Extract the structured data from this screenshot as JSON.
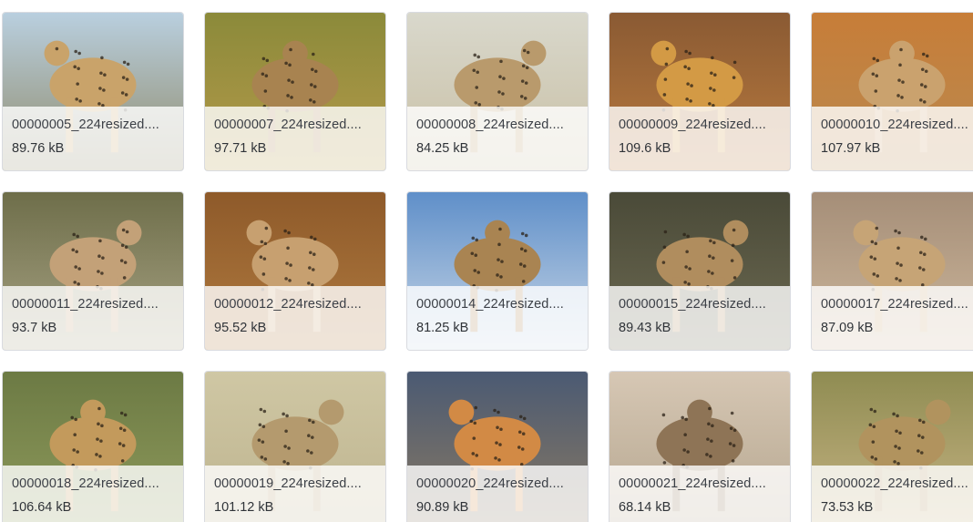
{
  "files": [
    {
      "name": "00000005_224resized....",
      "size": "89.76 kB",
      "colors": {
        "sky": "#b9cfdf",
        "ground": "#8f8a6a",
        "cat": "#c9a36a"
      }
    },
    {
      "name": "00000007_224resized....",
      "size": "97.71 kB",
      "colors": {
        "sky": "#8b8a3a",
        "ground": "#b59a4a",
        "cat": "#a88350"
      }
    },
    {
      "name": "00000008_224resized....",
      "size": "84.25 kB",
      "colors": {
        "sky": "#d9d8cc",
        "ground": "#c8bfa4",
        "cat": "#b99a6c"
      }
    },
    {
      "name": "00000009_224resized....",
      "size": "109.6 kB",
      "colors": {
        "sky": "#8a5a33",
        "ground": "#b97a3e",
        "cat": "#d39a45"
      }
    },
    {
      "name": "00000010_224resized....",
      "size": "107.97 kB",
      "colors": {
        "sky": "#c77d38",
        "ground": "#b98a50",
        "cat": "#caa26e"
      }
    },
    {
      "name": "00000011_224resized....",
      "size": "93.7 kB",
      "colors": {
        "sky": "#6e6e4a",
        "ground": "#a8a384",
        "cat": "#c3a178"
      }
    },
    {
      "name": "00000012_224resized....",
      "size": "95.52 kB",
      "colors": {
        "sky": "#8e5a2a",
        "ground": "#b07a3f",
        "cat": "#c7a070"
      }
    },
    {
      "name": "00000014_224resized....",
      "size": "81.25 kB",
      "colors": {
        "sky": "#5f8fc9",
        "ground": "#c9d7e6",
        "cat": "#a98452"
      }
    },
    {
      "name": "00000015_224resized....",
      "size": "89.43 kB",
      "colors": {
        "sky": "#4a4a38",
        "ground": "#6d6a52",
        "cat": "#b08d5e"
      }
    },
    {
      "name": "00000017_224resized....",
      "size": "87.09 kB",
      "colors": {
        "sky": "#a58e78",
        "ground": "#cdb79c",
        "cat": "#c6a476"
      }
    },
    {
      "name": "00000018_224resized....",
      "size": "106.64 kB",
      "colors": {
        "sky": "#6c7a44",
        "ground": "#8f9b5c",
        "cat": "#c39a5c"
      }
    },
    {
      "name": "00000019_224resized....",
      "size": "101.12 kB",
      "colors": {
        "sky": "#cfc7a4",
        "ground": "#bdb38e",
        "cat": "#b49a6e"
      }
    },
    {
      "name": "00000020_224resized....",
      "size": "90.89 kB",
      "colors": {
        "sky": "#4b5a73",
        "ground": "#8a7a62",
        "cat": "#d28a45"
      }
    },
    {
      "name": "00000021_224resized....",
      "size": "68.14 kB",
      "colors": {
        "sky": "#d6c7b4",
        "ground": "#b4a58e",
        "cat": "#8e7456"
      }
    },
    {
      "name": "00000022_224resized....",
      "size": "73.53 kB",
      "colors": {
        "sky": "#8f8c52",
        "ground": "#c7b484",
        "cat": "#b1935e"
      }
    }
  ]
}
